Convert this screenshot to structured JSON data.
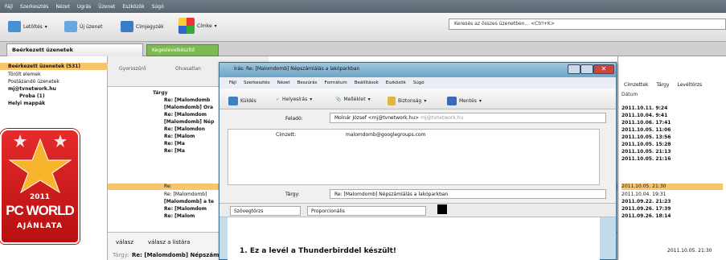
{
  "menubar": [
    "Fájl",
    "Szerkesztés",
    "Nézet",
    "Ugrás",
    "Üzenet",
    "Eszközök",
    "Súgó"
  ],
  "toolbar": {
    "get": "Letöltés",
    "new": "Új üzenet",
    "addressbook": "Címjegyzék",
    "tag": "Címke"
  },
  "search_placeholder": "Keresés az összes üzenetben... <Ctrl+K>",
  "tabs": [
    "Beérkezett üzenetek",
    "Kegeslevelkészítő"
  ],
  "folders": [
    "Beérkezett üzenetek (531)",
    "Törölt elemek",
    "Postázandó üzenetek",
    "mj@tvnetwork.hu",
    "Proba (1)",
    "Helyi mappák"
  ],
  "filter": {
    "a": "Gyorsszűrő",
    "b": "Olvasatlan",
    "col": "Tárgy"
  },
  "rows": [
    "Re: [Malomdomb",
    "[Malomdomb] Öra",
    "Re: [Malomdom",
    "[Malomdomb] Nép",
    "Re: [Malomdon",
    "Re: [Malom",
    "Re: [Ma",
    "Re: [Ma",
    "Re:",
    "Re: [Malomdomb]",
    "[Malomdomb] a te",
    "Re: [Malomdom",
    "Re: [Malom"
  ],
  "right_tabs": [
    "Címzettek",
    "Tárgy",
    "Levéltörzs"
  ],
  "date_col": "Dátum",
  "dates": [
    "2011.10.11. 9:24",
    "2011.10.04. 9:41",
    "2011.10.06. 17:41",
    "2011.10.05. 11:06",
    "2011.10.05. 13:56",
    "2011.10.05. 15:28",
    "2011.10.05. 21:13",
    "2011.10.05. 21:16",
    "2011.10.05. 21:30",
    "2011.10.04. 19:31",
    "2011.09.22. 21:23",
    "2011.09.26. 17:39",
    "2011.09.26. 18:14"
  ],
  "bottom": {
    "reply": "válasz",
    "replylist": "válasz a listára",
    "subject_lbl": "Tárgy:",
    "subject": "Re: [Malomdomb] Népszám",
    "date": "2011.10.05. 21:30"
  },
  "badge": {
    "year": "2011",
    "brand": "PC WORLD",
    "sub": "AJÁNLATA"
  },
  "compose": {
    "title": "Írás: Re: [Malomdomb] Népszámlálás a lakóparkban",
    "menu": [
      "Fájl",
      "Szerkesztés",
      "Nézet",
      "Beszúrás",
      "Formátum",
      "Beállítások",
      "Eszközök",
      "Súgó"
    ],
    "tools": [
      "Küldés",
      "Helyesírás",
      "Melléklet",
      "Biztonság",
      "Mentés"
    ],
    "from_lbl": "Feladó:",
    "from": "Molnár József <mj@tvnetwork.hu>",
    "from_hint": "mj@tvnetwork.hu",
    "to_lbl": "Címzett:",
    "to": "malomdomb@googlegroups.com",
    "subj_lbl": "Tárgy:",
    "subj": "Re: [Malomdomb] Népszámlálás a lakóparkban",
    "style": "Szövegtörzs",
    "font": "Proporcionális",
    "body": "1. Ez a levél a Thunderbirddel készült!"
  }
}
